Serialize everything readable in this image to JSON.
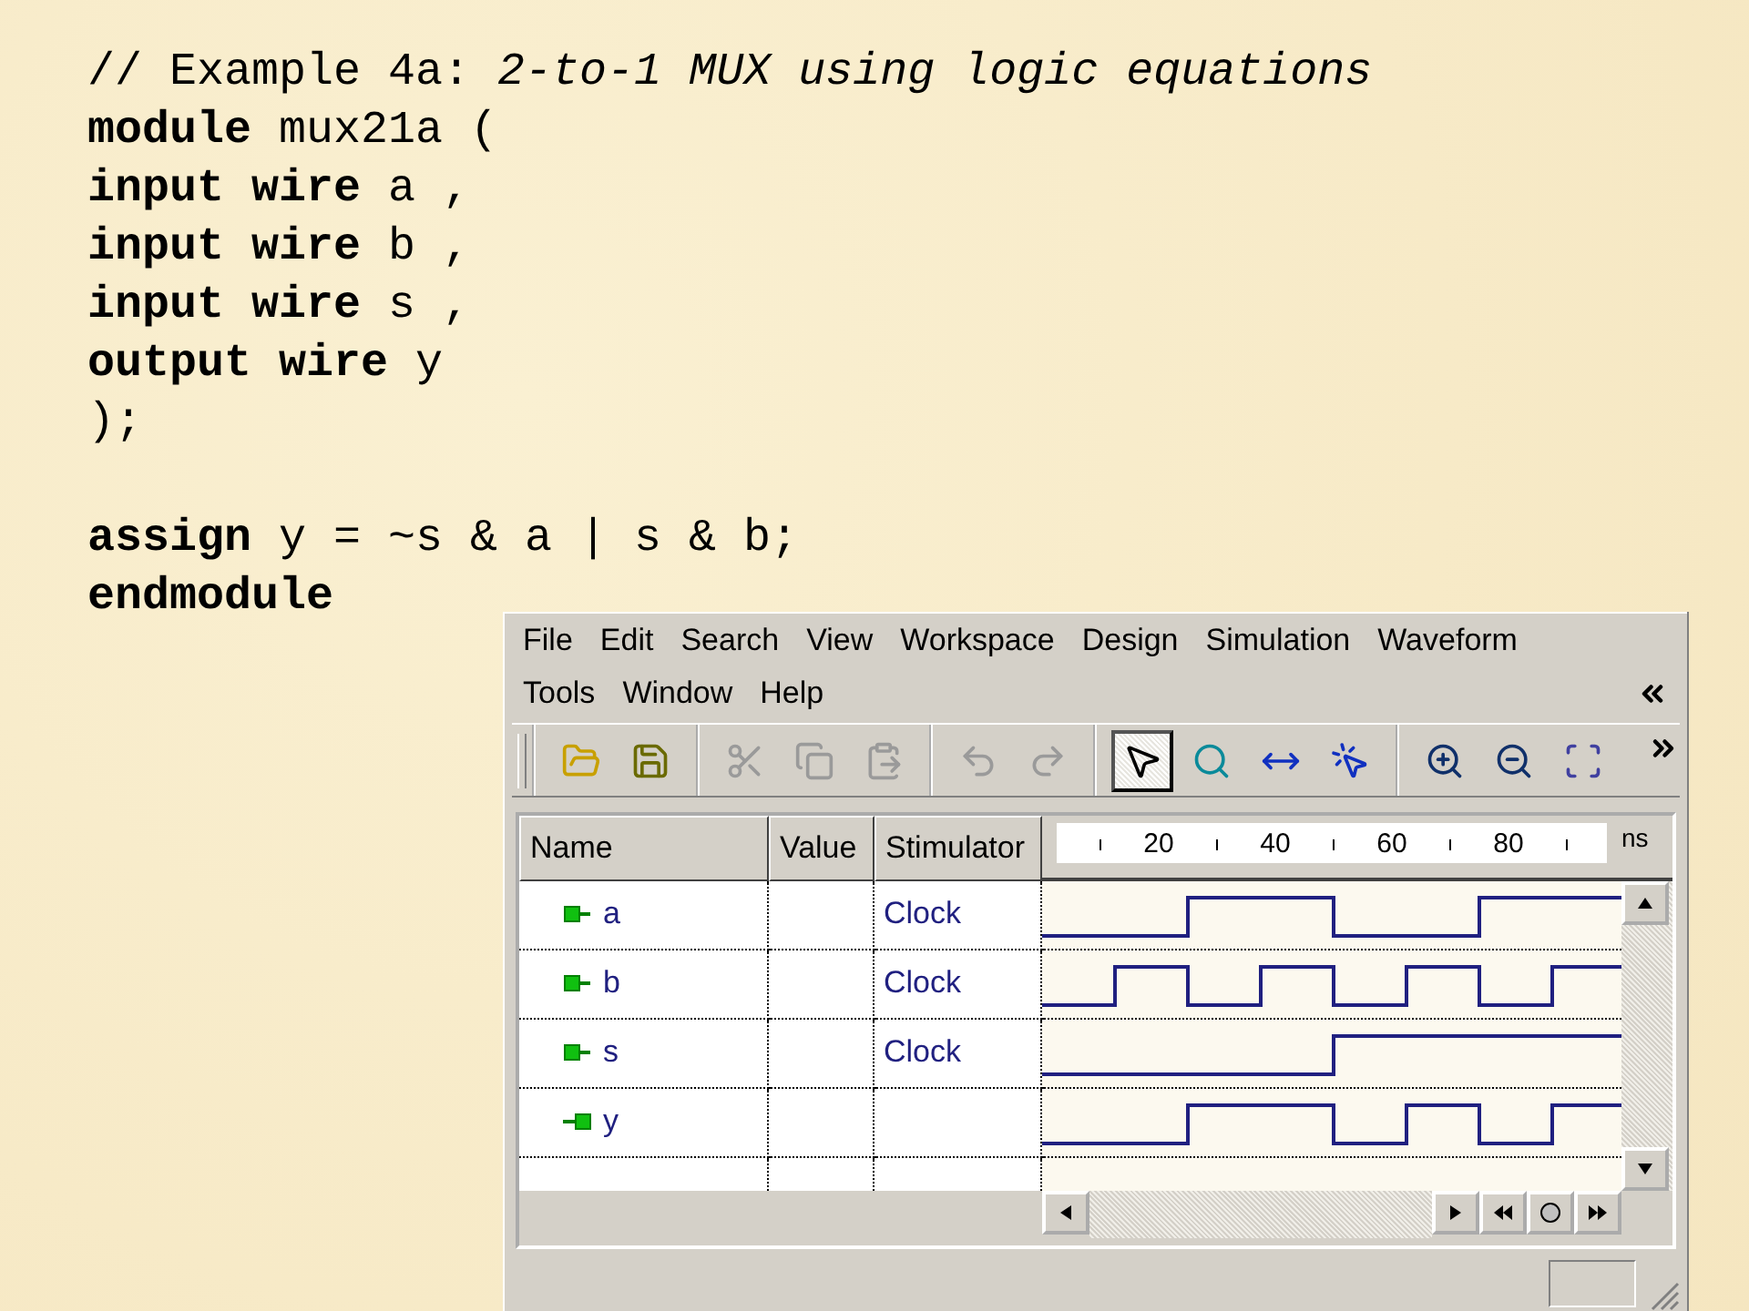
{
  "code_blocks": [
    [
      "// Example 4a: *2-to-1 MUX using logic equations*",
      "**module** mux21a (",
      "**input wire** a ,",
      "**input wire** b ,",
      "**input wire** s ,",
      "**output wire** y",
      ");"
    ],
    [
      "**assign** y = ~s & a | s & b;",
      "**endmodule**"
    ]
  ],
  "window": {
    "menu_rows": [
      [
        "File",
        "Edit",
        "Search",
        "View",
        "Workspace",
        "Design",
        "Simulation",
        "Waveform"
      ],
      [
        "Tools",
        "Window",
        "Help"
      ]
    ],
    "toolbar_groups": [
      [
        {
          "kind": "open",
          "disabled": false,
          "selected": false
        },
        {
          "kind": "save",
          "disabled": false,
          "selected": false
        }
      ],
      [
        {
          "kind": "cut",
          "disabled": true,
          "selected": false
        },
        {
          "kind": "copy",
          "disabled": true,
          "selected": false
        },
        {
          "kind": "paste",
          "disabled": true,
          "selected": false
        }
      ],
      [
        {
          "kind": "undo",
          "disabled": true,
          "selected": false
        },
        {
          "kind": "redo",
          "disabled": true,
          "selected": false
        }
      ],
      [
        {
          "kind": "pointer",
          "disabled": false,
          "selected": true
        },
        {
          "kind": "zoom",
          "disabled": false,
          "selected": false
        },
        {
          "kind": "measure",
          "disabled": false,
          "selected": false
        },
        {
          "kind": "select",
          "disabled": false,
          "selected": false
        }
      ],
      [
        {
          "kind": "zoom-in",
          "disabled": false,
          "selected": false
        },
        {
          "kind": "zoom-out",
          "disabled": false,
          "selected": false
        },
        {
          "kind": "zoom-fit",
          "disabled": false,
          "selected": false
        }
      ]
    ],
    "columns": [
      "Name",
      "Value",
      "Stimulator"
    ],
    "ruler": {
      "ticks": [
        "20",
        "40",
        "60",
        "80"
      ],
      "unit": "ns"
    },
    "signals": [
      {
        "name": "a",
        "kind": "input",
        "stimulator": "Clock"
      },
      {
        "name": "b",
        "kind": "input",
        "stimulator": "Clock"
      },
      {
        "name": "s",
        "kind": "input",
        "stimulator": "Clock"
      },
      {
        "name": "y",
        "kind": "output"
      }
    ]
  }
}
